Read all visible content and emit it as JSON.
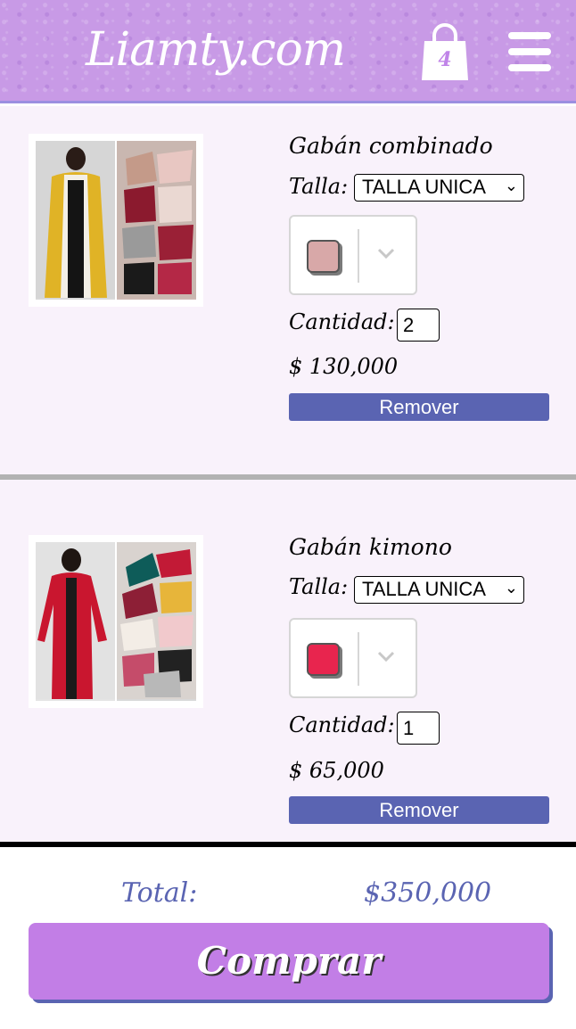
{
  "header": {
    "logo": "Liamty.com",
    "cart_count": "4",
    "icons": {
      "cart": "shopping-bag-icon",
      "menu": "hamburger-menu-icon"
    }
  },
  "colors": {
    "header_bg": "#c89ae6",
    "accent": "#5a64b2",
    "buy_button": "#c27ee6",
    "item_bg": "#f9f2fb"
  },
  "items": [
    {
      "name": "Gabán combinado",
      "size_label": "Talla:",
      "size_value": "TALLA UNICA",
      "color": "#d8a8a8",
      "qty_label": "Cantidad:",
      "qty_value": "2",
      "price": "$ 130,000",
      "remove_label": "Remover"
    },
    {
      "name": "Gabán kimono",
      "size_label": "Talla:",
      "size_value": "TALLA UNICA",
      "color": "#e8254e",
      "qty_label": "Cantidad:",
      "qty_value": "1",
      "price": "$ 65,000",
      "remove_label": "Remover"
    }
  ],
  "summary": {
    "total_label": "Total:",
    "total_value": "$350,000",
    "buy_label": "Comprar"
  }
}
